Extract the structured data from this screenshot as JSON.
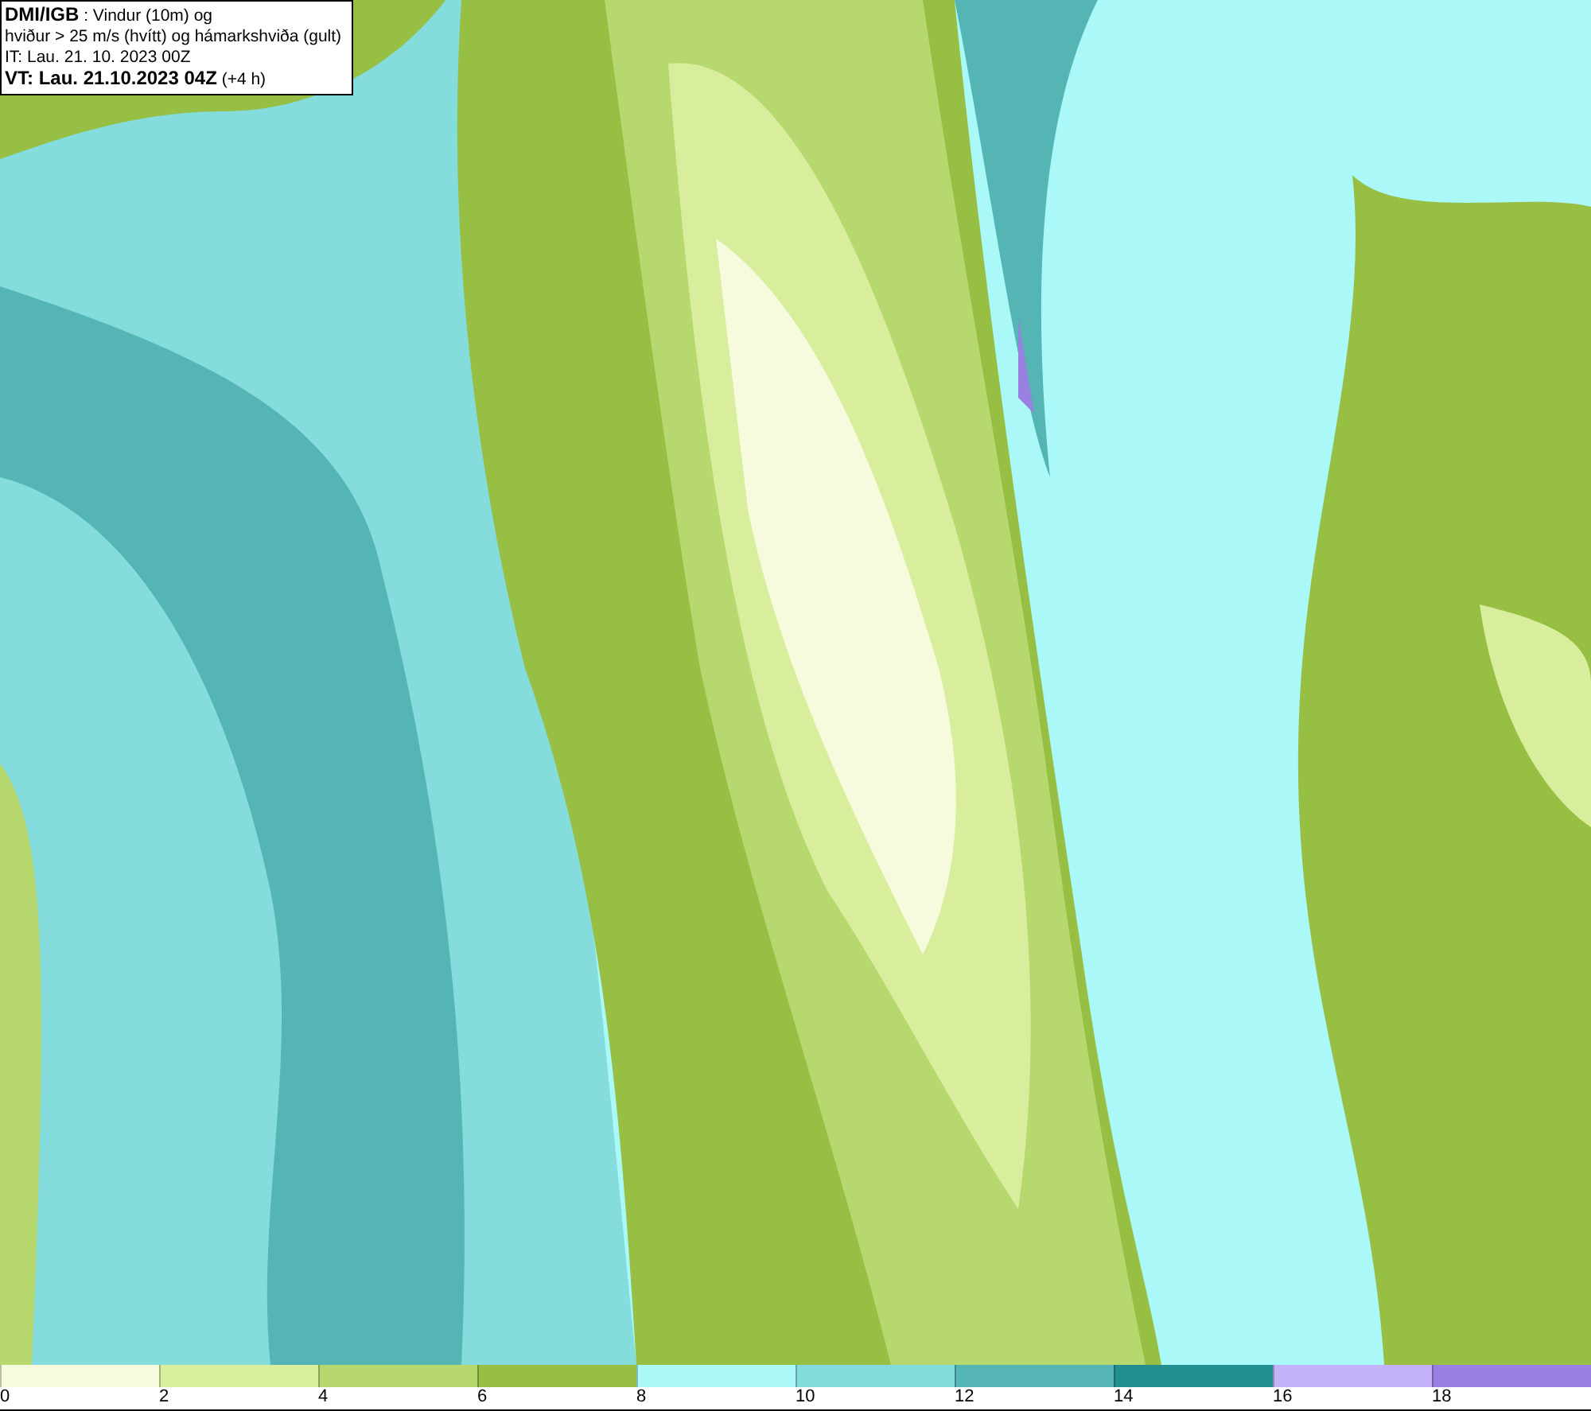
{
  "title_box": {
    "lines": [
      "**DMI/IGB** : Vindur (10m) og",
      "hviður > 25 m/s (hvítt) og hámarkshviða (gult)",
      "IT: Lau. 21. 10. 2023 00Z",
      "**VT: Lau. 21.10.2023 04Z** (+4 h)"
    ]
  },
  "legend": {
    "items": [
      {
        "label": "0",
        "color": "#f5fbdc"
      },
      {
        "label": "2",
        "color": "#d8ee9c"
      },
      {
        "label": "4",
        "color": "#b7d86e"
      },
      {
        "label": "6",
        "color": "#97bf44"
      },
      {
        "label": "8",
        "color": "#aaf8f8"
      },
      {
        "label": "10",
        "color": "#84dcdc"
      },
      {
        "label": "12",
        "color": "#55b5b5"
      },
      {
        "label": "14",
        "color": "#238e8e"
      },
      {
        "label": "16",
        "color": "#c3b1fa"
      },
      {
        "label": "18",
        "color": "#9a80e0"
      }
    ]
  }
}
